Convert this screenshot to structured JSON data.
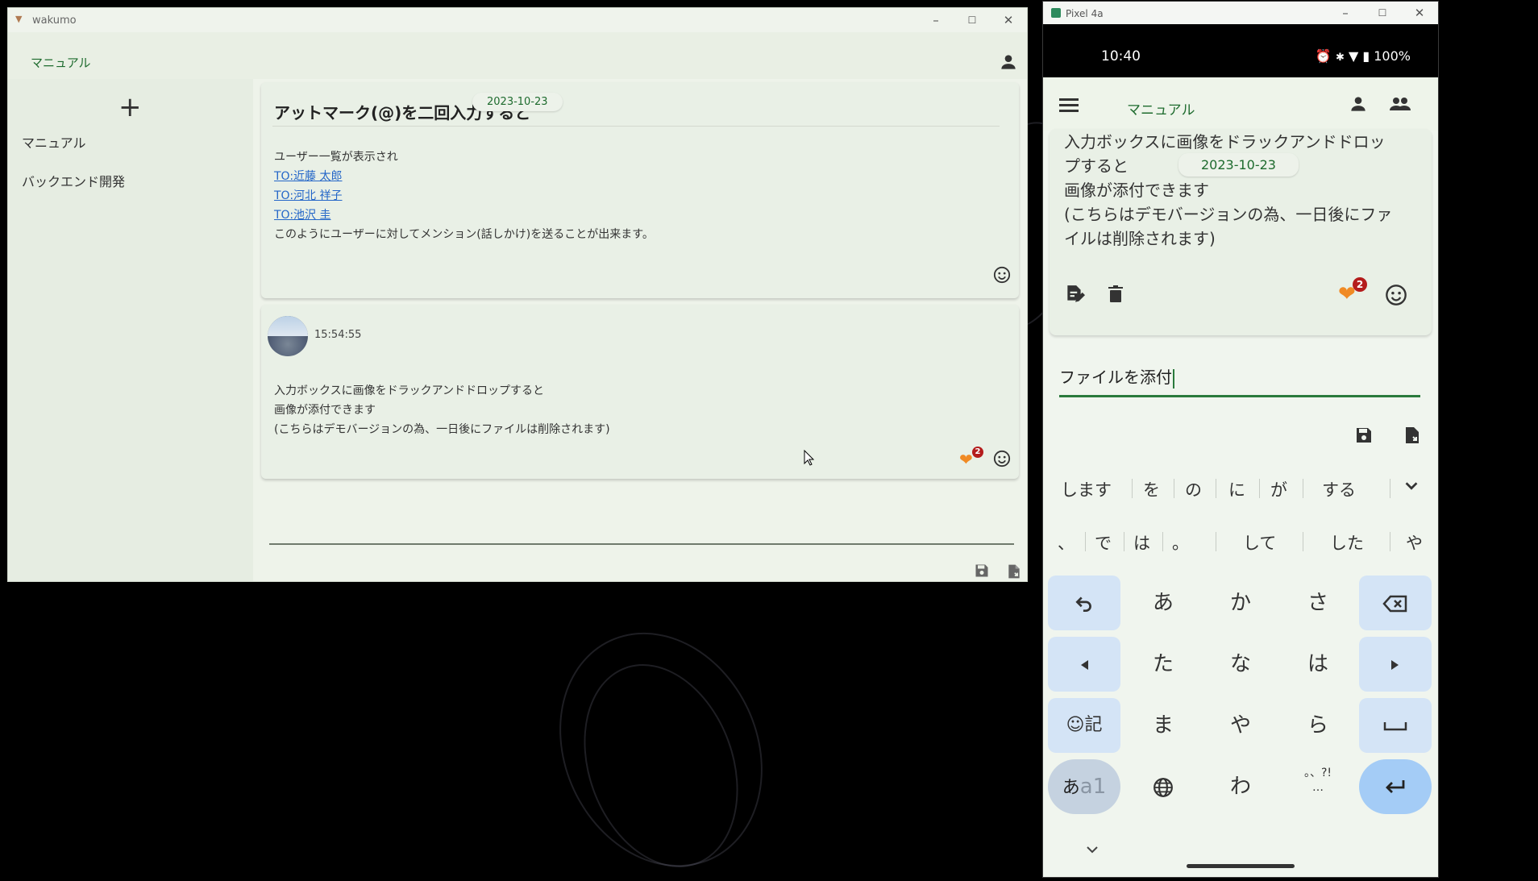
{
  "desktop_window": {
    "title": "wakumo",
    "app_title": "マニュアル",
    "sidebar": {
      "add_label": "+",
      "items": [
        "マニュアル",
        "バックエンド開発"
      ]
    },
    "card1": {
      "heading": "アットマーク(@)を二回入力すると",
      "date": "2023-10-23",
      "lines": [
        "ユーザー一覧が表示され",
        "TO:近藤 太郎",
        "TO:河北 祥子",
        "TO:池沢 圭",
        "このようにユーザーに対してメンション(話しかけ)を送ることが出来ます。"
      ]
    },
    "card2": {
      "time": "15:54:55",
      "lines": [
        "入力ボックスに画像をドラックアンドドロップすると",
        "画像が添付できます",
        "(こちらはデモバージョンの為、一日後にファイルは削除されます)"
      ],
      "reaction_count": "2"
    },
    "window_controls": [
      "–",
      "☐",
      "✕"
    ]
  },
  "phone_window": {
    "title": "Pixel 4a",
    "status": {
      "time": "10:40",
      "battery": "100%"
    },
    "app_title": "マニュアル",
    "card": {
      "lines": [
        "入力ボックスに画像をドラックアンドドロッ",
        "プすると",
        "画像が添付できます",
        "(こちらはデモバージョンの為、一日後にファ",
        "イルは削除されます)"
      ],
      "date": "2023-10-23",
      "reaction_count": "2"
    },
    "input_value": "ファイルを添付",
    "suggestions_row1": [
      "します",
      "を",
      "の",
      "に",
      "が",
      "する"
    ],
    "suggestions_row2": [
      "、",
      "で",
      "は",
      "。",
      "して",
      "した",
      "や"
    ],
    "keys": {
      "a": "あ",
      "ka": "か",
      "sa": "さ",
      "ta": "た",
      "na": "な",
      "ha": "は",
      "ma": "ま",
      "ya": "や",
      "ra": "ら",
      "wa": "わ",
      "emoji": "☺記",
      "mode_a": "あ",
      "mode_b": "a1",
      "punct": "。、?!",
      "ellipsis": "…"
    }
  },
  "colors": {
    "accent_green": "#1e6b2e",
    "heart": "#f08a24",
    "badge": "#b41c1c",
    "link": "#2466c8"
  }
}
